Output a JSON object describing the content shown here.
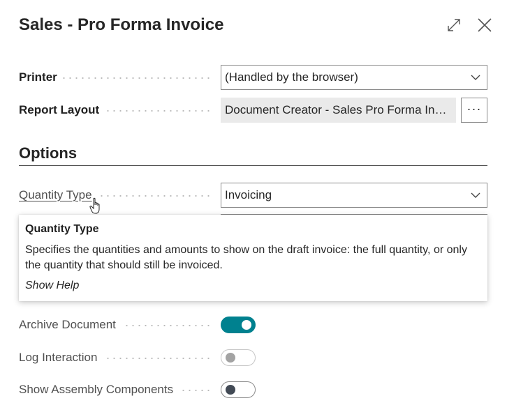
{
  "dialog": {
    "title": "Sales - Pro Forma Invoice",
    "icons": {
      "expand": "expand-icon",
      "close": "close-icon"
    }
  },
  "printer": {
    "label": "Printer",
    "value": "(Handled by the browser)"
  },
  "report_layout": {
    "label": "Report Layout",
    "value": "Document Creator - Sales Pro Forma Invoice",
    "more_label": "···"
  },
  "options": {
    "heading": "Options",
    "quantity_type": {
      "label": "Quantity Type",
      "value": "Invoicing"
    },
    "archive_document": {
      "label": "Archive Document",
      "checked": true
    },
    "log_interaction": {
      "label": "Log Interaction",
      "checked": false,
      "disabled": true
    },
    "show_assembly_components": {
      "label": "Show Assembly Components",
      "checked": false
    }
  },
  "tooltip": {
    "title": "Quantity Type",
    "body": "Specifies the quantities and amounts to show on the draft invoice: the full quantity, or only the quantity that should still be invoiced.",
    "link": "Show Help"
  },
  "colors": {
    "accent": "#00818f",
    "border": "#8a8a8a",
    "readonly_bg": "#eaeaea"
  }
}
